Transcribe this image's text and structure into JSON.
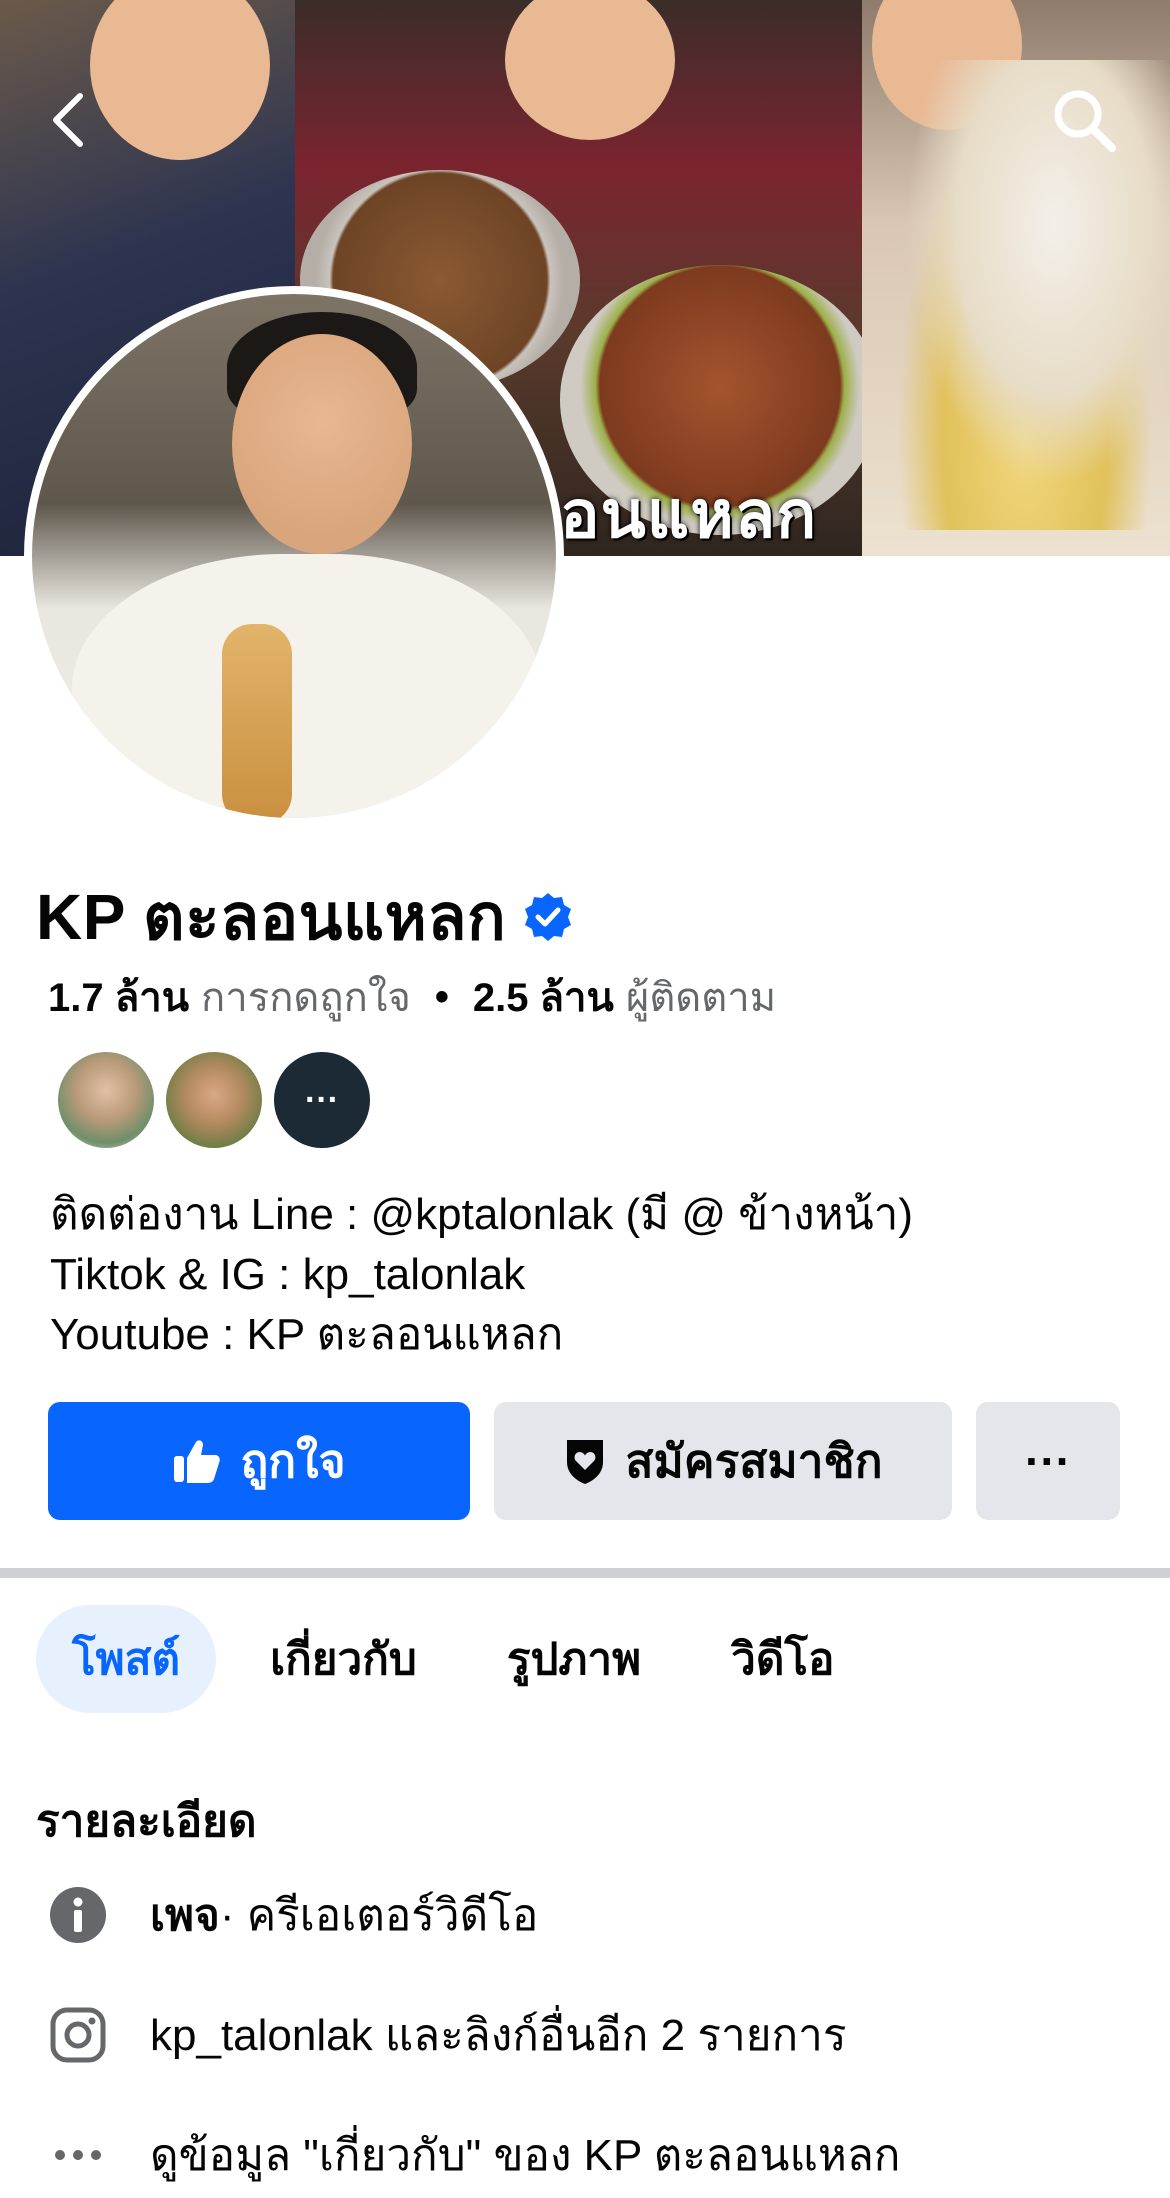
{
  "page": {
    "name": "KP ตะลอนแหลก",
    "cover_overlay_text": "อนแหลก"
  },
  "stats": {
    "likes_value": "1.7 ล้าน",
    "likes_label": "การกดถูกใจ",
    "separator": "•",
    "followers_value": "2.5 ล้าน",
    "followers_label": "ผู้ติดตาม"
  },
  "friends": {
    "more_label": "···"
  },
  "bio": {
    "line1": "ติดต่องาน Line : @kptalonlak (มี @ ข้างหน้า)",
    "line2": "Tiktok & IG : kp_talonlak",
    "line3": "Youtube : KP ตะลอนแหลก"
  },
  "actions": {
    "like_label": "ถูกใจ",
    "subscribe_label": "สมัครสมาชิก",
    "more_label": "···"
  },
  "tabs": [
    {
      "label": "โพสต์",
      "active": true
    },
    {
      "label": "เกี่ยวกับ",
      "active": false
    },
    {
      "label": "รูปภาพ",
      "active": false
    },
    {
      "label": "วิดีโอ",
      "active": false
    }
  ],
  "details": {
    "title": "รายละเอียด",
    "category_strong": "เพจ",
    "category_rest": " · ครีเอเตอร์วิดีโอ",
    "links": "kp_talonlak และลิงก์อื่นอีก 2 รายการ",
    "see_about": "ดูข้อมูล \"เกี่ยวกับ\" ของ KP ตะลอนแหลก"
  },
  "colors": {
    "brand_blue": "#0866ff",
    "secondary_gray": "#e4e6eb",
    "muted_text": "#65676b",
    "active_tab_bg": "#e7f1fe"
  },
  "icons": {
    "back": "chevron-left-icon",
    "search": "search-icon",
    "verified": "verified-badge-icon",
    "like": "thumbs-up-icon",
    "subscribe": "shield-heart-icon",
    "info": "info-icon",
    "instagram": "instagram-icon",
    "more": "more-dots-icon"
  }
}
